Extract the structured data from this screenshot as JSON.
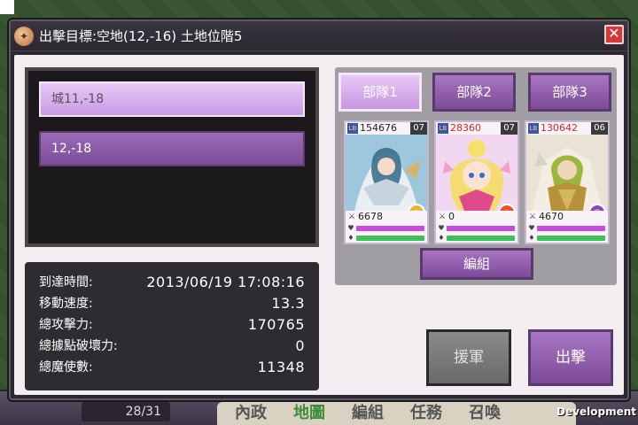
{
  "dialog": {
    "title": "出擊目標:空地(12,-16) 土地位階5",
    "close_label": "✕"
  },
  "targets": [
    {
      "label": "城11,-18",
      "selected": true
    },
    {
      "label": "12,-18",
      "selected": false
    }
  ],
  "info": {
    "rows": [
      {
        "label": "到達時間:",
        "value": "2013/06/19 17:08:16"
      },
      {
        "label": "移動速度:",
        "value": "13.3"
      },
      {
        "label": "總攻擊力:",
        "value": "170765"
      },
      {
        "label": "總據點破壞力:",
        "value": "0"
      },
      {
        "label": "總魔使數:",
        "value": "11348"
      }
    ]
  },
  "army": {
    "tabs": [
      "部隊1",
      "部隊2",
      "部隊3"
    ],
    "active_tab": 0,
    "cards": [
      {
        "power": "154676",
        "power_red": false,
        "level": "07",
        "stat": "6678",
        "element": "light",
        "element_color": "#e4b93a"
      },
      {
        "power": "28360",
        "power_red": true,
        "level": "07",
        "stat": "0",
        "element": "fire",
        "element_color": "#e2562a"
      },
      {
        "power": "130642",
        "power_red": true,
        "level": "06",
        "stat": "4670",
        "element": "dark",
        "element_color": "#8a4ab0"
      }
    ],
    "form_label": "編組"
  },
  "actions": {
    "reinforce_label": "援軍",
    "sortie_label": "出擊"
  },
  "background": {
    "troop_count": "28/31",
    "tabs": [
      "內政",
      "地圖",
      "編組",
      "任務",
      "召喚"
    ],
    "dev_label": "Development"
  },
  "colors": {
    "accent_purple": "#9c6bb4",
    "selected_purple": "#e6c8f5",
    "hp_bar": "#c84ae0",
    "stamina_bar": "#3fbf5a",
    "close_red": "#d23a3a"
  }
}
